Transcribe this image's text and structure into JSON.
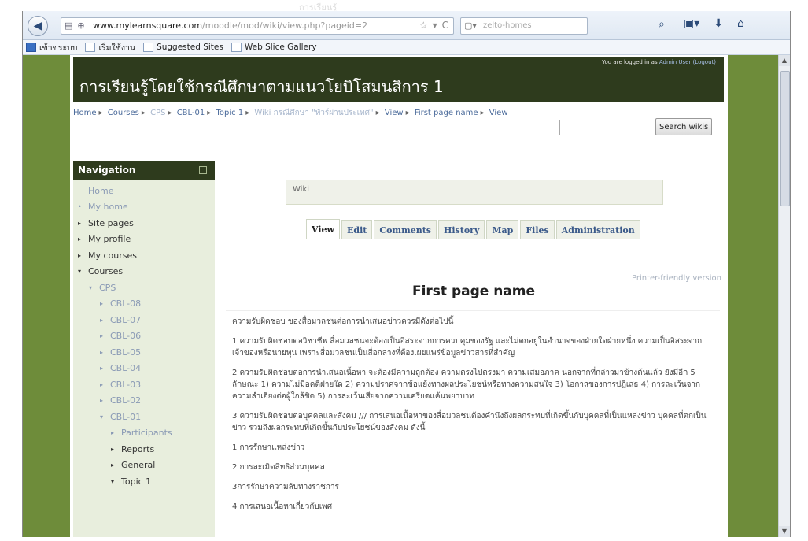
{
  "browser": {
    "url_domain": "www.mylearnsquare.com",
    "url_path": "/moodle/mod/wiki/view.php?pageid=2",
    "search_placeholder": "zelto-homes",
    "bookmarks": [
      "เข้าขระบบ",
      "เริ่มใช้งาน",
      "Suggested Sites",
      "Web Slice Gallery"
    ]
  },
  "header": {
    "site_title": "การเรียนรู้โดยใช้กรณีศึกษาตามแนวโยบิโสมนสิการ 1",
    "login_prefix": "You are logged in as",
    "login_user": "Admin User (Logout)"
  },
  "breadcrumb": [
    "Home",
    "Courses",
    "CPS",
    "CBL-01",
    "Topic 1",
    "Wiki กรณีศึกษา \"ทัวร์ผ่านประเทศ\"",
    "View",
    "First page name",
    "View"
  ],
  "wiki_search": {
    "button_label": "Search wikis"
  },
  "navigation": {
    "title": "Navigation",
    "items": [
      {
        "label": "Home",
        "tri": "",
        "indent": 0,
        "muted": true
      },
      {
        "label": "My home",
        "tri": "•",
        "indent": 0,
        "muted": true
      },
      {
        "label": "Site pages",
        "tri": "▸",
        "indent": 0,
        "muted": false
      },
      {
        "label": "My profile",
        "tri": "▸",
        "indent": 0,
        "muted": false
      },
      {
        "label": "My courses",
        "tri": "▸",
        "indent": 0,
        "muted": false
      },
      {
        "label": "Courses",
        "tri": "▾",
        "indent": 0,
        "muted": false
      },
      {
        "label": "CPS",
        "tri": "▾",
        "indent": 1,
        "muted": true
      },
      {
        "label": "CBL-08",
        "tri": "▸",
        "indent": 2,
        "muted": true
      },
      {
        "label": "CBL-07",
        "tri": "▸",
        "indent": 2,
        "muted": true
      },
      {
        "label": "CBL-06",
        "tri": "▸",
        "indent": 2,
        "muted": true
      },
      {
        "label": "CBL-05",
        "tri": "▸",
        "indent": 2,
        "muted": true
      },
      {
        "label": "CBL-04",
        "tri": "▸",
        "indent": 2,
        "muted": true
      },
      {
        "label": "CBL-03",
        "tri": "▸",
        "indent": 2,
        "muted": true
      },
      {
        "label": "CBL-02",
        "tri": "▸",
        "indent": 2,
        "muted": true
      },
      {
        "label": "CBL-01",
        "tri": "▾",
        "indent": 2,
        "muted": true
      },
      {
        "label": "Participants",
        "tri": "▸",
        "indent": 3,
        "muted": true
      },
      {
        "label": "Reports",
        "tri": "▸",
        "indent": 3,
        "muted": false
      },
      {
        "label": "General",
        "tri": "▸",
        "indent": 3,
        "muted": false
      },
      {
        "label": "Topic 1",
        "tri": "▾",
        "indent": 3,
        "muted": false
      }
    ]
  },
  "wiki": {
    "box_label": "Wiki",
    "tabs": [
      "View",
      "Edit",
      "Comments",
      "History",
      "Map",
      "Files",
      "Administration"
    ],
    "active_tab": "View",
    "printer_link": "Printer-friendly version",
    "page_title": "First page name",
    "paragraphs": [
      "ความรับผิดชอบ ของสื่อมวลชนต่อการนำเสนอข่าวควรมีดังต่อไปนี้",
      "1 ความรับผิดชอบต่อวิชาชีพ สื่อมวลชนจะต้องเป็นอิสระจากการควบคุมของรัฐ และไม่ตกอยู่ในอำนาจของฝ่ายใดฝ่ายหนึ่ง ความเป็นอิสระจากเจ้าของหรือนายทุน เพราะสื่อมวลชนเป็นสื่อกลางที่ต้องเผยแพร่ข้อมูลข่าวสารที่สำคัญ",
      "2 ความรับผิดชอบต่อการนำเสนอเนื้อหา จะต้องมีความถูกต้อง ความตรงไปตรงมา ความเสมอภาค นอกจากที่กล่าวมาข้างต้นแล้ว ยังมีอีก 5 ลักษณะ 1) ความไม่มีอคติฝ่ายใด 2) ความปราศจากข้อแย้งทางผลประโยชน์หรือทางความสนใจ 3) โอกาสของการปฏิเสธ 4) การละเว้นจากความลำเอียงต่อผู้ใกล้ชิด 5) การละเว้นเสียจากความเครียดแค้นพยาบาท",
      "3 ความรับผิดชอบต่อบุคคลและสังคม /// การเสนอเนื้อหาของสื่อมวลชนต้องคำนึงถึงผลกระทบที่เกิดขึ้นกับบุคคลที่เป็นแหล่งข่าว บุคคลที่ตกเป็นข่าว รวมถึงผลกระทบที่เกิดขึ้นกับประโยชน์ของสังคม ดังนี้",
      "1 การรักษาแหล่งข่าว",
      "2 การละเมิดสิทธิส่วนบุคคล",
      "3การรักษาความลับทางราชการ",
      "4 การเสนอเนื้อหาเกี่ยวกับเพศ"
    ]
  },
  "colors": {
    "page_bg": "#6e8c3a",
    "header_bg": "#2e3b1d",
    "nav_bg": "#e8eedd",
    "link": "#3b5a8a"
  }
}
